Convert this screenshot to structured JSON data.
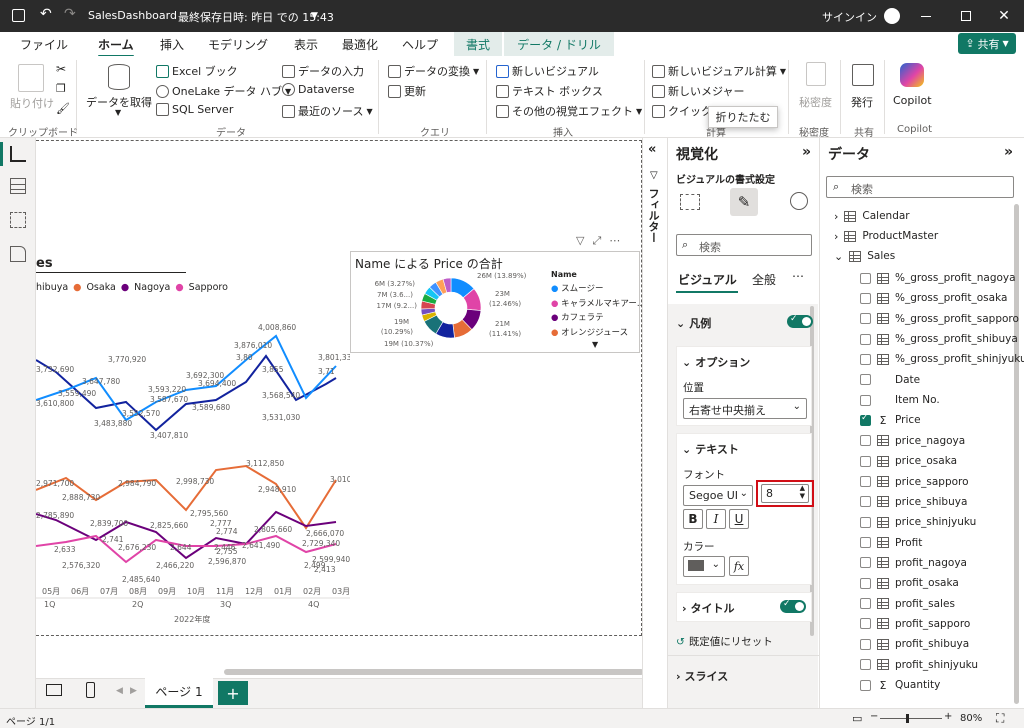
{
  "titlebar": {
    "filename": "SalesDashboard",
    "saved": "最終保存日時: 昨日 での 15:43",
    "signin": "サインイン"
  },
  "tabs": [
    "ファイル",
    "ホーム",
    "挿入",
    "モデリング",
    "表示",
    "最適化",
    "ヘルプ"
  ],
  "context_tabs": [
    "書式",
    "データ / ドリル"
  ],
  "share_label": "共有",
  "ribbon": {
    "paste": "貼り付け",
    "get_data": "データを取得",
    "excel": "Excel ブック",
    "onelake": "OneLake データ ハブ",
    "sql": "SQL Server",
    "enter_data": "データの入力",
    "dataverse": "Dataverse",
    "recent": "最近のソース",
    "transform": "データの変換",
    "refresh": "更新",
    "new_visual": "新しいビジュアル",
    "textbox": "テキスト ボックス",
    "more_visuals": "その他の視覚エフェクト",
    "new_visual_calc": "新しいビジュアル計算",
    "new_measure": "新しいメジャー",
    "quick": "クイック",
    "sensitivity": "秘密度",
    "publish": "発行",
    "copilot": "Copilot",
    "groups": [
      "クリップボード",
      "データ",
      "クエリ",
      "挿入",
      "計算",
      "秘密度",
      "共有",
      "Copilot"
    ],
    "tooltip": "折りたたむ"
  },
  "line_chart": {
    "title": "es",
    "legend": [
      "hibuya",
      "Osaka",
      "Nagoya",
      "Sapporo"
    ],
    "colors": {
      "shibuya": "#118dff",
      "osaka": "#e66c37",
      "nagoya": "#6b007b",
      "sapporo": "#e044a7",
      "shinjyuku": "#12239e"
    },
    "month_labels": [
      "05月",
      "06月",
      "07月",
      "08月",
      "09月",
      "10月",
      "11月",
      "12月",
      "01月",
      "02月",
      "03月"
    ],
    "quarter_labels": [
      "1Q",
      "2Q",
      "3Q",
      "4Q"
    ],
    "fiscal_label": "2022年度",
    "upper_labels": [
      "3,732,690",
      "3,770,920",
      "3,647,780",
      "3,559,490",
      "3,610,800",
      "3,483,880",
      "3,552,570",
      "3,593,220",
      "3,587,670",
      "3,407,810",
      "3,692,300",
      "3,694,400",
      "3,589,680",
      "3,876,010",
      "3,80",
      "3,855",
      "4,008,860",
      "3,801,330",
      "3,71",
      "3,568,540",
      "3,531,030"
    ],
    "lower_labels": [
      "2,971,700",
      "2,888,730",
      "2,785,890",
      "2,984,790",
      "2,998,730",
      "3,112,850",
      "2,948,910",
      "3,010,460",
      "2,839,700",
      "2,825,660",
      "2,795,560",
      "2,741",
      "2,676,230",
      "2,633",
      "2,644",
      "2,777",
      "2,774",
      "2,755",
      "2,805,660",
      "2,666,070",
      "2,576,320",
      "2,466,220",
      "2,596,870",
      "2,641,490",
      "2,729,340",
      "2,599,940",
      "2,485,640",
      "2,499",
      "2,413",
      "2,446"
    ]
  },
  "donut_chart": {
    "title": "Name による Price の合計",
    "legend_title": "Name",
    "legend": [
      "スムージー",
      "キャラメルマキアー...",
      "カフェラテ",
      "オレンジジュース"
    ],
    "labels": [
      "26M (13.89%)",
      "23M (12.46%)",
      "21M (11.41%)",
      "19M (10.37%)",
      "19M (10.29%)",
      "17M (9.2...)",
      "7M (3.6...)",
      "6M (3.27%)"
    ]
  },
  "chart_data": {
    "type": "pie",
    "title": "Name による Price の合計",
    "slices": [
      {
        "label": "26M (13.89%)",
        "value": 13.89
      },
      {
        "label": "23M (12.46%)",
        "value": 12.46
      },
      {
        "label": "21M (11.41%)",
        "value": 11.41
      },
      {
        "label": "19M (10.37%)",
        "value": 10.37
      },
      {
        "label": "19M (10.29%)",
        "value": 10.29
      },
      {
        "label": "17M (9.2...)",
        "value": 9.2
      },
      {
        "label": "7M (3.6...)",
        "value": 3.6
      },
      {
        "label": "6M (3.27%)",
        "value": 3.27
      },
      {
        "label": "",
        "value": 25.51
      }
    ],
    "legend": [
      "スムージー",
      "キャラメルマキアー...",
      "カフェラテ",
      "オレンジジュース"
    ],
    "legend_colors": [
      "#118dff",
      "#e044a7",
      "#6b007b",
      "#e66c37"
    ]
  },
  "filters_label": "フィルター",
  "viz_pane": {
    "title": "視覚化",
    "subtitle": "ビジュアルの書式設定",
    "search": "検索",
    "tab_visual": "ビジュアル",
    "tab_general": "全般",
    "legend_section": "凡例",
    "options_section": "オプション",
    "position_label": "位置",
    "position_value": "右寄せ中央揃え",
    "text_section": "テキスト",
    "font_label": "フォント",
    "font_value": "Segoe UI",
    "font_size": "8",
    "bold": "B",
    "italic": "I",
    "underline": "U",
    "color_label": "カラー",
    "fx": "fx",
    "title_section": "タイトル",
    "reset": "既定値にリセット",
    "slice_section": "スライス"
  },
  "data_pane": {
    "title": "データ",
    "search": "検索",
    "tables": [
      "Calendar",
      "ProductMaster",
      "Sales"
    ],
    "fields": [
      {
        "name": "%_gross_profit_nagoya",
        "icon": "table",
        "checked": false
      },
      {
        "name": "%_gross_profit_osaka",
        "icon": "table",
        "checked": false
      },
      {
        "name": "%_gross_profit_sapporo",
        "icon": "table",
        "checked": false
      },
      {
        "name": "%_gross_profit_shibuya",
        "icon": "table",
        "checked": false
      },
      {
        "name": "%_gross_profit_shinjyuku",
        "icon": "table",
        "checked": false
      },
      {
        "name": "Date",
        "icon": "none",
        "checked": false
      },
      {
        "name": "Item No.",
        "icon": "none",
        "checked": false
      },
      {
        "name": "Price",
        "icon": "sigma",
        "checked": true
      },
      {
        "name": "price_nagoya",
        "icon": "table",
        "checked": false
      },
      {
        "name": "price_osaka",
        "icon": "table",
        "checked": false
      },
      {
        "name": "price_sapporo",
        "icon": "table",
        "checked": false
      },
      {
        "name": "price_shibuya",
        "icon": "table",
        "checked": false
      },
      {
        "name": "price_shinjyuku",
        "icon": "table",
        "checked": false
      },
      {
        "name": "Profit",
        "icon": "table",
        "checked": false
      },
      {
        "name": "profit_nagoya",
        "icon": "table",
        "checked": false
      },
      {
        "name": "profit_osaka",
        "icon": "table",
        "checked": false
      },
      {
        "name": "profit_sales",
        "icon": "table",
        "checked": false
      },
      {
        "name": "profit_sapporo",
        "icon": "table",
        "checked": false
      },
      {
        "name": "profit_shibuya",
        "icon": "table",
        "checked": false
      },
      {
        "name": "profit_shinjyuku",
        "icon": "table",
        "checked": false
      },
      {
        "name": "Quantity",
        "icon": "sigma",
        "checked": false
      }
    ]
  },
  "page_tab": "ページ 1",
  "status": {
    "page": "ページ 1/1",
    "zoom": "80%"
  }
}
